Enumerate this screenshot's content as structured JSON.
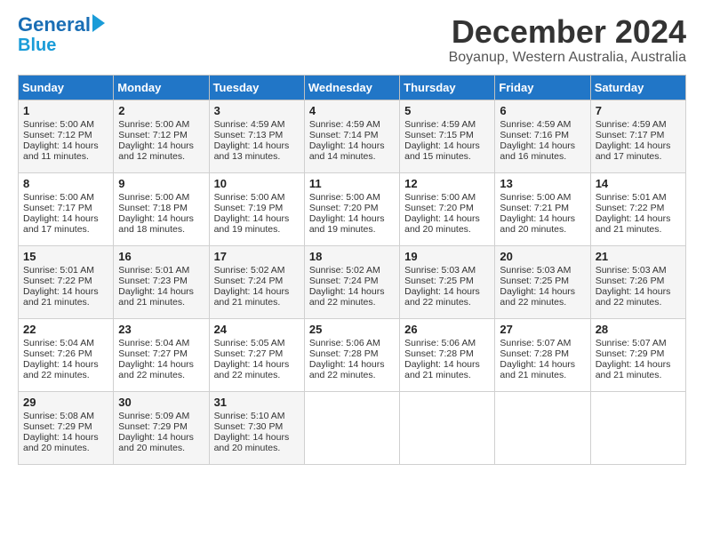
{
  "logo": {
    "line1": "General",
    "line2": "Blue",
    "arrow": true
  },
  "title": "December 2024",
  "location": "Boyanup, Western Australia, Australia",
  "days_of_week": [
    "Sunday",
    "Monday",
    "Tuesday",
    "Wednesday",
    "Thursday",
    "Friday",
    "Saturday"
  ],
  "weeks": [
    [
      {
        "day": 1,
        "lines": [
          "Sunrise: 5:00 AM",
          "Sunset: 7:12 PM",
          "Daylight: 14 hours",
          "and 11 minutes."
        ]
      },
      {
        "day": 2,
        "lines": [
          "Sunrise: 5:00 AM",
          "Sunset: 7:12 PM",
          "Daylight: 14 hours",
          "and 12 minutes."
        ]
      },
      {
        "day": 3,
        "lines": [
          "Sunrise: 4:59 AM",
          "Sunset: 7:13 PM",
          "Daylight: 14 hours",
          "and 13 minutes."
        ]
      },
      {
        "day": 4,
        "lines": [
          "Sunrise: 4:59 AM",
          "Sunset: 7:14 PM",
          "Daylight: 14 hours",
          "and 14 minutes."
        ]
      },
      {
        "day": 5,
        "lines": [
          "Sunrise: 4:59 AM",
          "Sunset: 7:15 PM",
          "Daylight: 14 hours",
          "and 15 minutes."
        ]
      },
      {
        "day": 6,
        "lines": [
          "Sunrise: 4:59 AM",
          "Sunset: 7:16 PM",
          "Daylight: 14 hours",
          "and 16 minutes."
        ]
      },
      {
        "day": 7,
        "lines": [
          "Sunrise: 4:59 AM",
          "Sunset: 7:17 PM",
          "Daylight: 14 hours",
          "and 17 minutes."
        ]
      }
    ],
    [
      {
        "day": 8,
        "lines": [
          "Sunrise: 5:00 AM",
          "Sunset: 7:17 PM",
          "Daylight: 14 hours",
          "and 17 minutes."
        ]
      },
      {
        "day": 9,
        "lines": [
          "Sunrise: 5:00 AM",
          "Sunset: 7:18 PM",
          "Daylight: 14 hours",
          "and 18 minutes."
        ]
      },
      {
        "day": 10,
        "lines": [
          "Sunrise: 5:00 AM",
          "Sunset: 7:19 PM",
          "Daylight: 14 hours",
          "and 19 minutes."
        ]
      },
      {
        "day": 11,
        "lines": [
          "Sunrise: 5:00 AM",
          "Sunset: 7:20 PM",
          "Daylight: 14 hours",
          "and 19 minutes."
        ]
      },
      {
        "day": 12,
        "lines": [
          "Sunrise: 5:00 AM",
          "Sunset: 7:20 PM",
          "Daylight: 14 hours",
          "and 20 minutes."
        ]
      },
      {
        "day": 13,
        "lines": [
          "Sunrise: 5:00 AM",
          "Sunset: 7:21 PM",
          "Daylight: 14 hours",
          "and 20 minutes."
        ]
      },
      {
        "day": 14,
        "lines": [
          "Sunrise: 5:01 AM",
          "Sunset: 7:22 PM",
          "Daylight: 14 hours",
          "and 21 minutes."
        ]
      }
    ],
    [
      {
        "day": 15,
        "lines": [
          "Sunrise: 5:01 AM",
          "Sunset: 7:22 PM",
          "Daylight: 14 hours",
          "and 21 minutes."
        ]
      },
      {
        "day": 16,
        "lines": [
          "Sunrise: 5:01 AM",
          "Sunset: 7:23 PM",
          "Daylight: 14 hours",
          "and 21 minutes."
        ]
      },
      {
        "day": 17,
        "lines": [
          "Sunrise: 5:02 AM",
          "Sunset: 7:24 PM",
          "Daylight: 14 hours",
          "and 21 minutes."
        ]
      },
      {
        "day": 18,
        "lines": [
          "Sunrise: 5:02 AM",
          "Sunset: 7:24 PM",
          "Daylight: 14 hours",
          "and 22 minutes."
        ]
      },
      {
        "day": 19,
        "lines": [
          "Sunrise: 5:03 AM",
          "Sunset: 7:25 PM",
          "Daylight: 14 hours",
          "and 22 minutes."
        ]
      },
      {
        "day": 20,
        "lines": [
          "Sunrise: 5:03 AM",
          "Sunset: 7:25 PM",
          "Daylight: 14 hours",
          "and 22 minutes."
        ]
      },
      {
        "day": 21,
        "lines": [
          "Sunrise: 5:03 AM",
          "Sunset: 7:26 PM",
          "Daylight: 14 hours",
          "and 22 minutes."
        ]
      }
    ],
    [
      {
        "day": 22,
        "lines": [
          "Sunrise: 5:04 AM",
          "Sunset: 7:26 PM",
          "Daylight: 14 hours",
          "and 22 minutes."
        ]
      },
      {
        "day": 23,
        "lines": [
          "Sunrise: 5:04 AM",
          "Sunset: 7:27 PM",
          "Daylight: 14 hours",
          "and 22 minutes."
        ]
      },
      {
        "day": 24,
        "lines": [
          "Sunrise: 5:05 AM",
          "Sunset: 7:27 PM",
          "Daylight: 14 hours",
          "and 22 minutes."
        ]
      },
      {
        "day": 25,
        "lines": [
          "Sunrise: 5:06 AM",
          "Sunset: 7:28 PM",
          "Daylight: 14 hours",
          "and 22 minutes."
        ]
      },
      {
        "day": 26,
        "lines": [
          "Sunrise: 5:06 AM",
          "Sunset: 7:28 PM",
          "Daylight: 14 hours",
          "and 21 minutes."
        ]
      },
      {
        "day": 27,
        "lines": [
          "Sunrise: 5:07 AM",
          "Sunset: 7:28 PM",
          "Daylight: 14 hours",
          "and 21 minutes."
        ]
      },
      {
        "day": 28,
        "lines": [
          "Sunrise: 5:07 AM",
          "Sunset: 7:29 PM",
          "Daylight: 14 hours",
          "and 21 minutes."
        ]
      }
    ],
    [
      {
        "day": 29,
        "lines": [
          "Sunrise: 5:08 AM",
          "Sunset: 7:29 PM",
          "Daylight: 14 hours",
          "and 20 minutes."
        ]
      },
      {
        "day": 30,
        "lines": [
          "Sunrise: 5:09 AM",
          "Sunset: 7:29 PM",
          "Daylight: 14 hours",
          "and 20 minutes."
        ]
      },
      {
        "day": 31,
        "lines": [
          "Sunrise: 5:10 AM",
          "Sunset: 7:30 PM",
          "Daylight: 14 hours",
          "and 20 minutes."
        ]
      },
      null,
      null,
      null,
      null
    ]
  ]
}
